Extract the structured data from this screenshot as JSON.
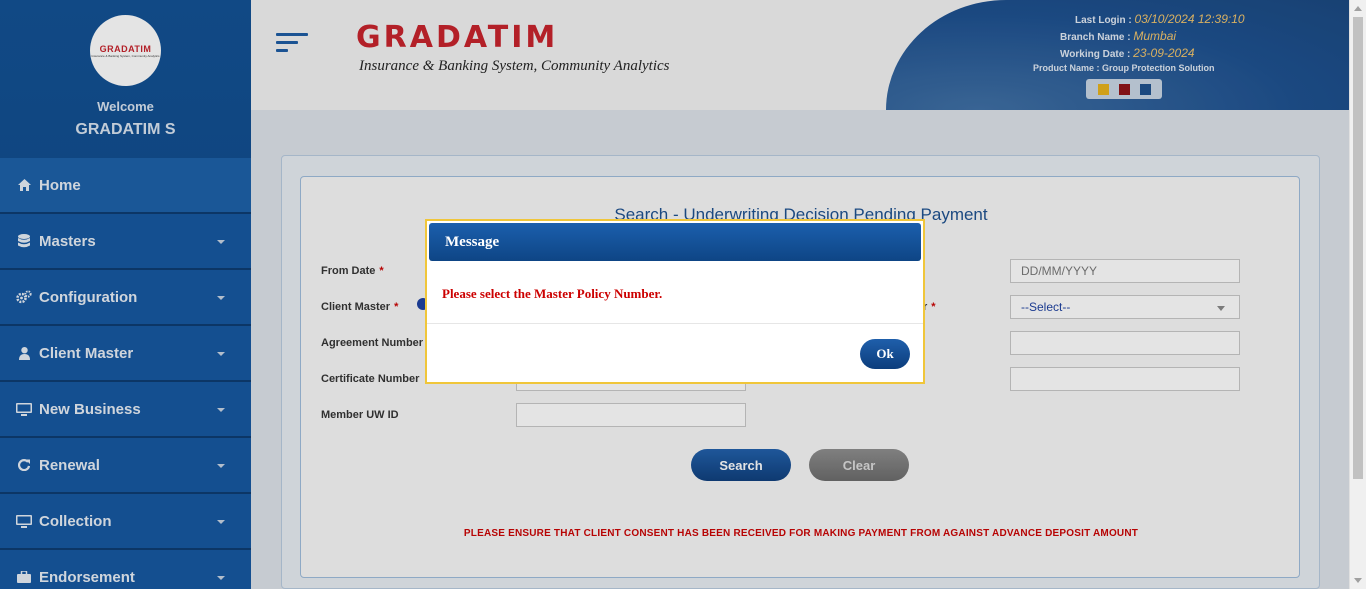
{
  "sidebar": {
    "avatar_logo": "GRADATIM",
    "avatar_tagline": "Insurance & Banking System, Community Analytics",
    "welcome": "Welcome",
    "username": "GRADATIM S",
    "items": [
      {
        "label": "Home",
        "icon": "home-icon"
      },
      {
        "label": "Masters",
        "icon": "database-icon"
      },
      {
        "label": "Configuration",
        "icon": "gears-icon"
      },
      {
        "label": "Client Master",
        "icon": "user-icon"
      },
      {
        "label": "New Business",
        "icon": "monitor-icon"
      },
      {
        "label": "Renewal",
        "icon": "refresh-icon"
      },
      {
        "label": "Collection",
        "icon": "monitor-icon"
      },
      {
        "label": "Endorsement",
        "icon": "briefcase-icon"
      }
    ]
  },
  "header": {
    "brand": "GRADATIM",
    "tagline": "Insurance & Banking System, Community Analytics",
    "last_login_label": "Last Login :",
    "last_login_value": "03/10/2024 12:39:10",
    "branch_label": "Branch Name :",
    "branch_value": "Mumbai",
    "working_date_label": "Working Date :",
    "working_date_value": "23-09-2024",
    "product_label": "Product Name : Group Protection Solution",
    "theme_colors": [
      "#e8b21a",
      "#8f0f14",
      "#1c4f8d"
    ]
  },
  "form": {
    "title": "Search - Underwriting Decision Pending Payment",
    "from_date_label": "From Date",
    "client_master_label": "Client Master",
    "agreement_number_label": "Agreement Number",
    "certificate_number_label": "Certificate Number",
    "member_uw_id_label": "Member UW ID",
    "required_mark": "*",
    "partial_label": "r",
    "to_date_placeholder": "DD/MM/YYYY",
    "select_value": "--Select--",
    "search_button": "Search",
    "clear_button": "Clear",
    "notice": "PLEASE ENSURE THAT CLIENT CONSENT HAS BEEN RECEIVED FOR MAKING PAYMENT FROM AGAINST ADVANCE DEPOSIT AMOUNT"
  },
  "modal": {
    "title": "Message",
    "message": "Please select the Master Policy Number.",
    "ok_button": "Ok"
  }
}
